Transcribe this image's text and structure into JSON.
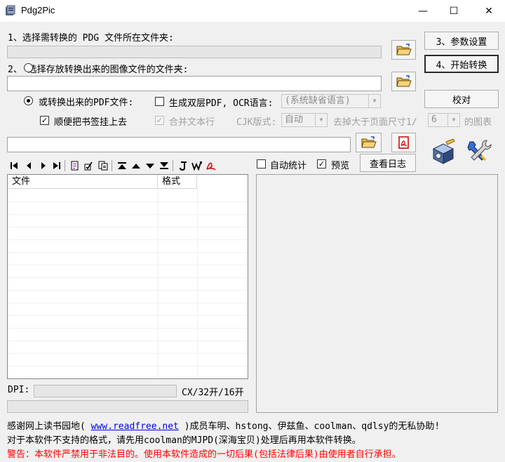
{
  "window": {
    "title": "Pdg2Pic",
    "minimize": "—",
    "maximize": "☐",
    "close": "✕"
  },
  "step1": {
    "label": "1、选择需转换的 PDG 文件所在文件夹:"
  },
  "step2": {
    "label": "2、 选择存放转换出来的图像文件的文件夹:"
  },
  "pdf_option": {
    "label": "或转换出来的PDF文件:"
  },
  "bilayer": {
    "label": "生成双层PDF, OCR语言:",
    "language": "(系统缺省语言)"
  },
  "bookmark": {
    "label": "顺便把书签挂上去"
  },
  "merge_lines": {
    "label": "合并文本行"
  },
  "cjk": {
    "label": "CJK版式:",
    "value": "自动"
  },
  "remove_large": {
    "prefix": "去掉大于页面尺寸1/",
    "value": "6",
    "suffix": "的图表"
  },
  "buttons": {
    "settings": "3、参数设置",
    "convert": "4、开始转换",
    "verify": "校对",
    "log": "查看日志"
  },
  "auto_stats": {
    "label": "自动统计"
  },
  "preview": {
    "label": "预览"
  },
  "file_list": {
    "columns": [
      "文件",
      "格式"
    ]
  },
  "dpi": {
    "label": "DPI:",
    "size_text": "CX/32开/16开"
  },
  "footer": {
    "credits_prefix": "感谢网上读书园地(",
    "credits_link": "www.readfree.net",
    "credits_suffix": ")成员车明、hstong、伊兹鱼、coolman、qdlsy的无私协助!",
    "unsupported": "对于本软件不支持的格式，请先用coolman的MJPD(深海宝贝)处理后再用本软件转换。",
    "warning": "警告：本软件严禁用于非法目的。使用本软件造成的一切后果(包括法律后果)由使用者自行承担。"
  },
  "colors": {
    "link": "#0000ee",
    "warning": "#ff0000"
  }
}
